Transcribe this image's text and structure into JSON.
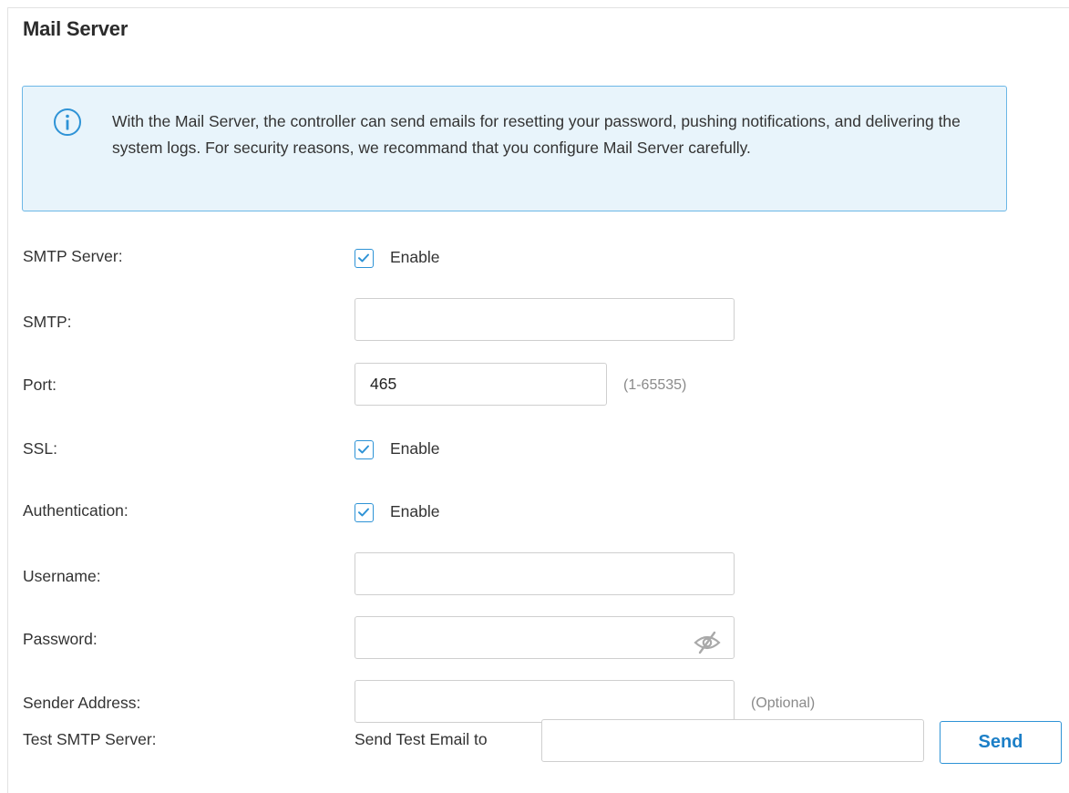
{
  "section": {
    "title": "Mail Server"
  },
  "notice": {
    "icon": "info-icon",
    "text": "With the Mail Server, the controller can send emails for resetting your password, pushing notifications, and delivering the system logs. For security reasons, we recommand that you configure Mail Server carefully."
  },
  "form": {
    "smtp_server": {
      "label": "SMTP Server:",
      "checkbox_label": "Enable",
      "checked": true
    },
    "smtp": {
      "label": "SMTP:",
      "value": ""
    },
    "port": {
      "label": "Port:",
      "value": "465",
      "hint": "(1-65535)"
    },
    "ssl": {
      "label": "SSL:",
      "checkbox_label": "Enable",
      "checked": true
    },
    "authentication": {
      "label": "Authentication:",
      "checkbox_label": "Enable",
      "checked": true
    },
    "username": {
      "label": "Username:",
      "value": ""
    },
    "password": {
      "label": "Password:",
      "value": "",
      "toggle_icon": "eye-off-icon"
    },
    "sender_address": {
      "label": "Sender Address:",
      "value": "",
      "hint": "(Optional)"
    },
    "test_smtp": {
      "label": "Test SMTP Server:",
      "inline_label": "Send Test Email to",
      "value": "",
      "button_label": "Send"
    }
  },
  "colors": {
    "accent": "#2e93d6",
    "notice_bg": "#e8f4fb",
    "notice_border": "#6cb7e6",
    "button_text": "#1c7fc7"
  }
}
